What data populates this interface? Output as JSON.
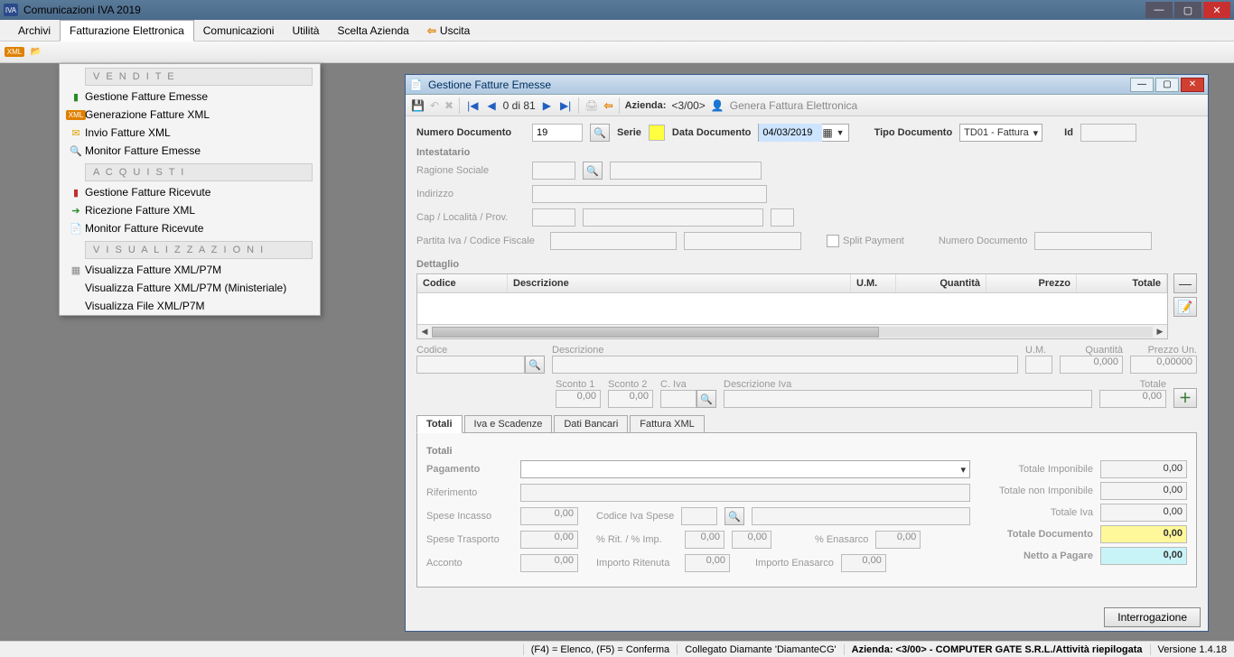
{
  "app": {
    "title": "Comunicazioni IVA 2019"
  },
  "menubar": {
    "archivi": "Archivi",
    "fatt_elettr": "Fatturazione Elettronica",
    "comunicazioni": "Comunicazioni",
    "utilita": "Utilità",
    "scelta_azienda": "Scelta Azienda",
    "uscita": "Uscita"
  },
  "dropdown": {
    "h_vendite": "V E N D I T E",
    "gestione_emesse": "Gestione Fatture Emesse",
    "gen_xml": "Generazione Fatture XML",
    "invio_xml": "Invio Fatture XML",
    "monitor_emesse": "Monitor Fatture Emesse",
    "h_acquisti": "A C Q U I S T I",
    "gestione_ricevute": "Gestione Fatture Ricevute",
    "ricezione_xml": "Ricezione Fatture XML",
    "monitor_ricevute": "Monitor Fatture Ricevute",
    "h_vis": "V I S U A L I Z Z A Z I O N I",
    "vis_p7m": "Visualizza Fatture XML/P7M",
    "vis_min": "Visualizza Fatture XML/P7M (Ministeriale)",
    "vis_file": "Visualizza File XML/P7M"
  },
  "child": {
    "title": "Gestione Fatture Emesse",
    "pager": "0 di 81",
    "azienda_lbl": "Azienda:",
    "azienda_val": "<3/00>",
    "gen_fatt": "Genera Fattura Elettronica",
    "num_doc_lbl": "Numero Documento",
    "num_doc_val": "19",
    "serie_lbl": "Serie",
    "data_doc_lbl": "Data Documento",
    "data_doc_val": "04/03/2019",
    "tipo_doc_lbl": "Tipo Documento",
    "tipo_doc_val": "TD01 - Fattura",
    "id_lbl": "Id",
    "sect_intestatario": "Intestatario",
    "ragione": "Ragione Sociale",
    "indirizzo": "Indirizzo",
    "cap": "Cap / Località / Prov.",
    "piva": "Partita Iva / Codice Fiscale",
    "split": "Split Payment",
    "num_doc2": "Numero Documento",
    "sect_dettaglio": "Dettaglio",
    "col_codice": "Codice",
    "col_descr": "Descrizione",
    "col_um": "U.M.",
    "col_qta": "Quantità",
    "col_prezzo": "Prezzo",
    "col_totale": "Totale",
    "f_codice": "Codice",
    "f_descr": "Descrizione",
    "f_um": "U.M.",
    "f_qta": "Quantità",
    "f_qta_val": "0,000",
    "f_prezzo": "Prezzo Un.",
    "f_prezzo_val": "0,00000",
    "f_sconto1": "Sconto 1",
    "f_sconto1_val": "0,00",
    "f_sconto2": "Sconto 2",
    "f_sconto2_val": "0,00",
    "f_civa": "C. Iva",
    "f_descr_iva": "Descrizione Iva",
    "f_totale": "Totale",
    "f_totale_val": "0,00",
    "tab_totali": "Totali",
    "tab_iva": "Iva e Scadenze",
    "tab_banc": "Dati Bancari",
    "tab_xml": "Fattura XML",
    "sect_totali": "Totali",
    "pagamento": "Pagamento",
    "riferimento": "Riferimento",
    "spese_inc": "Spese Incasso",
    "spese_inc_val": "0,00",
    "cod_iva_spese": "Codice Iva Spese",
    "spese_trasp": "Spese Trasporto",
    "spese_trasp_val": "0,00",
    "rit_imp": "% Rit. / % Imp.",
    "rit_val": "0,00",
    "imp_val": "0,00",
    "enasarco_lbl": "% Enasarco",
    "enasarco_val": "0,00",
    "acconto": "Acconto",
    "acconto_val": "0,00",
    "imp_rit": "Importo Ritenuta",
    "imp_rit_val": "0,00",
    "imp_ena": "Importo Enasarco",
    "imp_ena_val": "0,00",
    "tot_imp": "Totale Imponibile",
    "tot_imp_val": "0,00",
    "tot_nimp": "Totale non Imponibile",
    "tot_nimp_val": "0,00",
    "tot_iva": "Totale Iva",
    "tot_iva_val": "0,00",
    "tot_doc": "Totale Documento",
    "tot_doc_val": "0,00",
    "netto": "Netto a Pagare",
    "netto_val": "0,00",
    "interrog": "Interrogazione"
  },
  "status": {
    "keys": "(F4) = Elenco,  (F5) = Conferma",
    "collegato": "Collegato Diamante 'DiamanteCG'",
    "azienda": "Azienda: <3/00> - COMPUTER GATE S.R.L./Attività riepilogata",
    "versione": "Versione 1.4.18"
  }
}
